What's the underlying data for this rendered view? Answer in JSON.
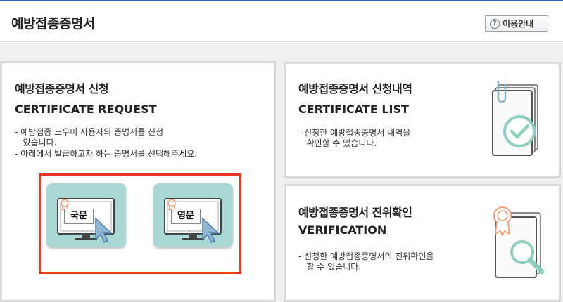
{
  "header": {
    "title": "예방접종증명서",
    "help_label": "이용안내"
  },
  "request_card": {
    "title_ko": "예방접종증명서 신청",
    "title_en": "CERTIFICATE REQUEST",
    "desc_line1": "- 예방접종 도우미 사용자의 증명서를 신청\n   있습니다.",
    "desc_line2": "- 아래에서 발급하고자 하는 증명서를 선택해주세요.",
    "korean_label": "국문",
    "english_label": "영문"
  },
  "list_card": {
    "title_ko": "예방접종증명서 신청내역",
    "title_en": "CERTIFICATE LIST",
    "desc": "- 신청한 예방접종증명서 내역을\n   확인할 수 있습니다."
  },
  "verify_card": {
    "title_ko": "예방접종증명서 진위확인",
    "title_en": "VERIFICATION",
    "desc": "- 신청한 예방접종증명서의 진위확인을\n   할 수 있습니다."
  }
}
